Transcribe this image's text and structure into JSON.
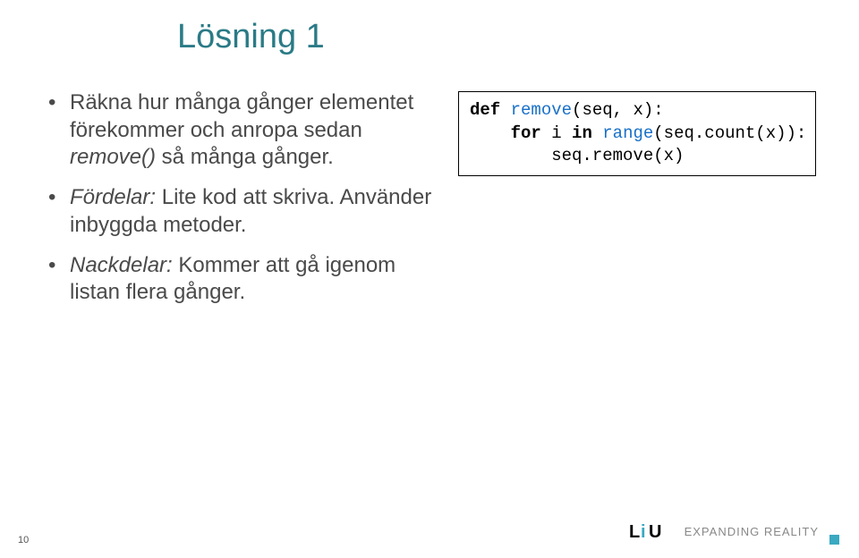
{
  "title": "Lösning 1",
  "bullets": [
    {
      "prefix": "",
      "italic": "",
      "text1": "Räkna hur många gånger elementet förekommer och anropa sedan ",
      "italic2": "remove()",
      "text2": " så många gånger."
    },
    {
      "prefix": "",
      "italic": "Fördelar:",
      "text1": " Lite kod att skriva. Använder inbyggda metoder.",
      "italic2": "",
      "text2": ""
    },
    {
      "prefix": "",
      "italic": "Nackdelar:",
      "text1": " Kommer att gå igenom listan flera gånger.",
      "italic2": "",
      "text2": ""
    }
  ],
  "code": {
    "line1_kw": "def",
    "line1_fn": "remove",
    "line1_rest": "(seq, x):",
    "line2_indent": "    ",
    "line2_kw1": "for",
    "line2_mid": " i ",
    "line2_kw2": "in",
    "line2_fn": " range",
    "line2_rest": "(seq.count(x)):",
    "line3_indent": "        ",
    "line3_text": "seq.remove(x)"
  },
  "page_number": "10",
  "footer": {
    "logo_text": "LiU",
    "tagline": "EXPANDING REALITY"
  }
}
